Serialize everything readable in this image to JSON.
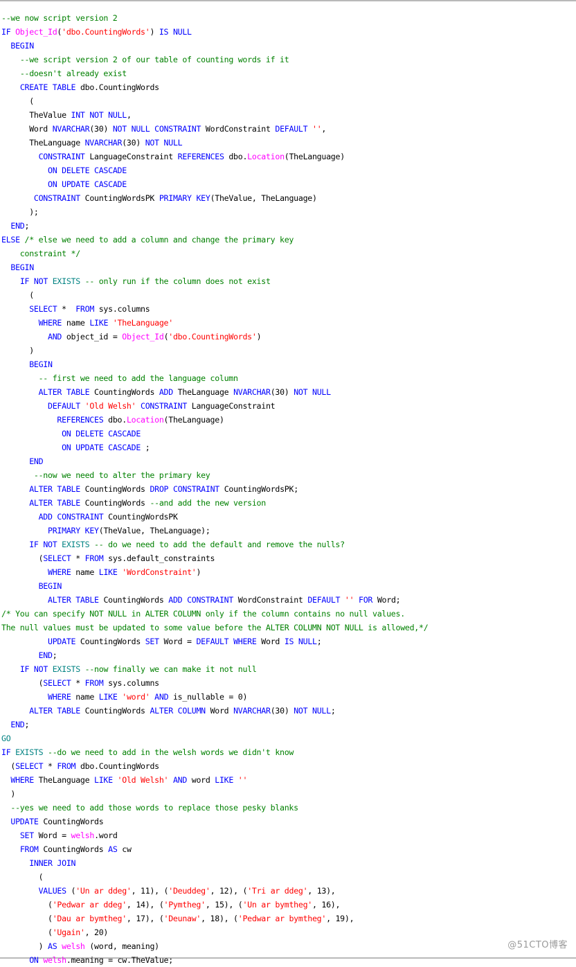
{
  "editor": {
    "language": "T-SQL",
    "background_color": "#ffffff",
    "default_text_color": "#000000",
    "colors": {
      "keyword": "#0000ff",
      "keyword_alt": "#008282",
      "function": "#ff00ff",
      "string": "#ff0000",
      "comment": "#008000",
      "plain": "#000000",
      "operator": "#808080",
      "border": "#b9b9b9"
    }
  },
  "watermark": {
    "text": "@51CTO博客"
  },
  "code": {
    "lines": [
      "--we now script version 2",
      "IF Object_Id('dbo.CountingWords') IS NULL",
      "  BEGIN",
      "    --we script version 2 of our table of counting words if it",
      "    --doesn't already exist",
      "    CREATE TABLE dbo.CountingWords",
      "      (",
      "      TheValue INT NOT NULL,",
      "      Word NVARCHAR(30) NOT NULL CONSTRAINT WordConstraint DEFAULT '',",
      "      TheLanguage NVARCHAR(30) NOT NULL",
      "        CONSTRAINT LanguageConstraint REFERENCES dbo.Location(TheLanguage)",
      "          ON DELETE CASCADE",
      "          ON UPDATE CASCADE",
      "       CONSTRAINT CountingWordsPK PRIMARY KEY(TheValue, TheLanguage)",
      "      );",
      "  END;",
      "ELSE /* else we need to add a column and change the primary key",
      "    constraint */",
      "  BEGIN",
      "    IF NOT EXISTS -- only run if the column does not exist",
      "      (",
      "      SELECT *  FROM sys.columns",
      "        WHERE name LIKE 'TheLanguage'",
      "          AND object_id = Object_Id('dbo.CountingWords')",
      "      )",
      "      BEGIN",
      "        -- first we need to add the language column",
      "        ALTER TABLE CountingWords ADD TheLanguage NVARCHAR(30) NOT NULL",
      "          DEFAULT 'Old Welsh' CONSTRAINT LanguageConstraint",
      "            REFERENCES dbo.Location(TheLanguage)",
      "             ON DELETE CASCADE",
      "             ON UPDATE CASCADE ;",
      "      END",
      "       --now we need to alter the primary key",
      "      ALTER TABLE CountingWords DROP CONSTRAINT CountingWordsPK;",
      "      ALTER TABLE CountingWords --and add the new version",
      "        ADD CONSTRAINT CountingWordsPK",
      "          PRIMARY KEY(TheValue, TheLanguage);",
      "      IF NOT EXISTS -- do we need to add the default and remove the nulls?",
      "        (SELECT * FROM sys.default_constraints",
      "          WHERE name LIKE 'WordConstraint')",
      "        BEGIN",
      "          ALTER TABLE CountingWords ADD CONSTRAINT WordConstraint DEFAULT '' FOR Word;",
      "/* You can specify NOT NULL in ALTER COLUMN only if the column contains no null values.",
      "The null values must be updated to some value before the ALTER COLUMN NOT NULL is allowed,*/",
      "          UPDATE CountingWords SET Word = DEFAULT WHERE Word IS NULL;",
      "        END;",
      "    IF NOT EXISTS --now finally we can make it not null",
      "        (SELECT * FROM sys.columns",
      "          WHERE name LIKE 'word' AND is_nullable = 0)",
      "      ALTER TABLE CountingWords ALTER COLUMN Word NVARCHAR(30) NOT NULL;",
      "  END;",
      "GO",
      "IF EXISTS --do we need to add in the welsh words we didn't know",
      "  (SELECT * FROM dbo.CountingWords",
      "  WHERE TheLanguage LIKE 'Old Welsh' AND word LIKE ''",
      "  )",
      "  --yes we need to add those words to replace those pesky blanks",
      "  UPDATE CountingWords",
      "    SET Word = welsh.word",
      "    FROM CountingWords AS cw",
      "      INNER JOIN",
      "        (",
      "        VALUES ('Un ar ddeg', 11), ('Deuddeg', 12), ('Tri ar ddeg', 13),",
      "          ('Pedwar ar ddeg', 14), ('Pymtheg', 15), ('Un ar bymtheg', 16),",
      "          ('Dau ar bymtheg', 17), ('Deunaw', 18), ('Pedwar ar bymtheg', 19),",
      "          ('Ugain', 20)",
      "        ) AS welsh (word, meaning)",
      "      ON welsh.meaning = cw.TheValue;"
    ],
    "welsh_number_words": [
      {
        "word": "Un ar ddeg",
        "value": 11
      },
      {
        "word": "Deuddeg",
        "value": 12
      },
      {
        "word": "Tri ar ddeg",
        "value": 13
      },
      {
        "word": "Pedwar ar ddeg",
        "value": 14
      },
      {
        "word": "Pymtheg",
        "value": 15
      },
      {
        "word": "Un ar bymtheg",
        "value": 16
      },
      {
        "word": "Dau ar bymtheg",
        "value": 17
      },
      {
        "word": "Deunaw",
        "value": 18
      },
      {
        "word": "Pedwar ar bymtheg",
        "value": 19
      },
      {
        "word": "Ugain",
        "value": 20
      }
    ]
  }
}
